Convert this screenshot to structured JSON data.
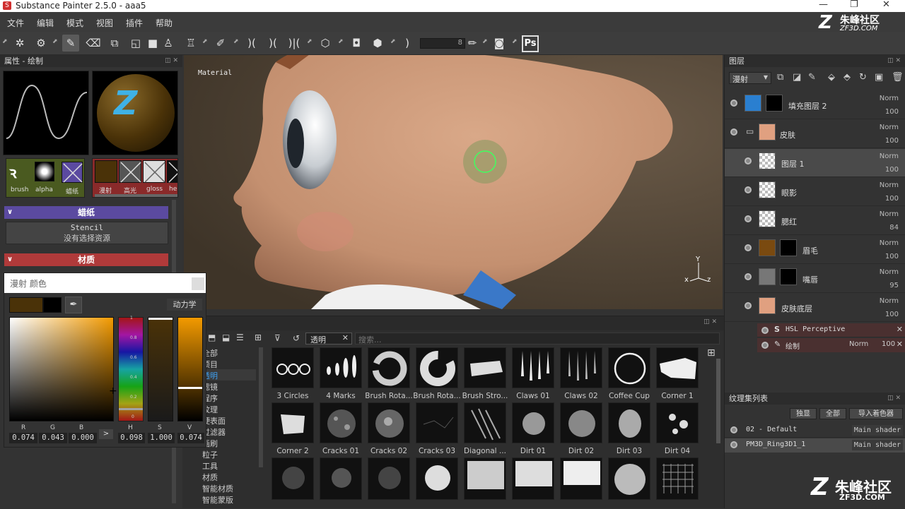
{
  "window": {
    "title": "Substance Painter 2.5.0 - aaa5",
    "logo_letter": "S",
    "controls": [
      "—",
      "❐",
      "✕"
    ]
  },
  "menu": [
    "文件",
    "编辑",
    "模式",
    "视图",
    "插件",
    "帮助"
  ],
  "toolbar": {
    "brush_size_value": "8",
    "ps_label": "Ps"
  },
  "watermark": {
    "top_brand": "朱峰社区",
    "top_url": "ZF3D.COM",
    "bottom_brand": "朱峰社区",
    "bottom_url": "ZF3D.COM"
  },
  "properties": {
    "title": "属性 - 绘制",
    "brush_slots": [
      "brush",
      "alpha",
      "蜡纸"
    ],
    "material_slots": [
      "漫射",
      "高光",
      "gloss",
      "hei"
    ],
    "stencil_section": "蜡纸",
    "stencil_label": "Stencil",
    "stencil_empty": "没有选择资源",
    "material_section": "材质"
  },
  "viewport": {
    "label": "Material",
    "axis_x": "x",
    "axis_y": "Y",
    "axis_z": "z"
  },
  "color_picker": {
    "title": "漫射 颜色",
    "dynamics_label": "动力学",
    "swatch_color": "#4a3208",
    "channels": [
      {
        "label": "R",
        "value": "0.074"
      },
      {
        "label": "G",
        "value": "0.043"
      },
      {
        "label": "B",
        "value": "0.000"
      },
      {
        "label": "H",
        "value": "0.098"
      },
      {
        "label": "S",
        "value": "1.000"
      },
      {
        "label": "V",
        "value": "0.074"
      }
    ],
    "scale_ticks": [
      "1",
      "0.8",
      "0.6",
      "0.4",
      "0.2",
      "0"
    ],
    "more_label": ">"
  },
  "shelf": {
    "filter_tag": "透明",
    "search_placeholder": "搜索...",
    "categories": [
      "全部",
      "项目",
      "透明",
      "滤镜",
      "程序",
      "纹理",
      "硬表面",
      "过滤器",
      "画刷",
      "粒子",
      "工具",
      "材质",
      "智能材质",
      "智能蒙版"
    ],
    "items_row1": [
      "3 Circles",
      "4 Marks",
      "Brush Rota...",
      "Brush Rota...",
      "Brush Stro...",
      "Claws 01",
      "Claws 02",
      "Coffee Cup",
      "Corner 1"
    ],
    "items_row2": [
      "Corner 2",
      "Cracks 01",
      "Cracks 02",
      "Cracks 03",
      "Diagonal ...",
      "Dirt 01",
      "Dirt 02",
      "Dirt 03",
      "Dirt 04"
    ]
  },
  "layers": {
    "title": "图层",
    "channel_select": "漫射",
    "rows": [
      {
        "name": "填充图层 2",
        "mode": "Norm",
        "opacity": "100"
      },
      {
        "name": "皮肤",
        "mode": "Norm",
        "opacity": "100"
      },
      {
        "name": "图层 1",
        "mode": "Norm",
        "opacity": "100"
      },
      {
        "name": "眼影",
        "mode": "Norm",
        "opacity": "100"
      },
      {
        "name": "腮红",
        "mode": "Norm",
        "opacity": "84"
      },
      {
        "name": "眉毛",
        "mode": "Norm",
        "opacity": "100"
      },
      {
        "name": "嘴唇",
        "mode": "Norm",
        "opacity": "95"
      },
      {
        "name": "皮肤底层",
        "mode": "Norm",
        "opacity": "100"
      }
    ],
    "effects": [
      {
        "name": "HSL Perceptive",
        "mode": "",
        "opacity": ""
      },
      {
        "name": "绘制",
        "mode": "Norm",
        "opacity": "100"
      }
    ]
  },
  "texture_sets": {
    "title": "纹理集列表",
    "buttons": [
      "独显",
      "全部",
      "导入着色器"
    ],
    "items": [
      {
        "name": "02 - Default",
        "shader": "Main shader"
      },
      {
        "name": "PM3D_Ring3D1_1",
        "shader": "Main shader"
      }
    ]
  },
  "colors": {
    "accent_purple": "#5b4aa0",
    "accent_red": "#b03a3a",
    "highlight_blue": "#2a7fd0"
  }
}
